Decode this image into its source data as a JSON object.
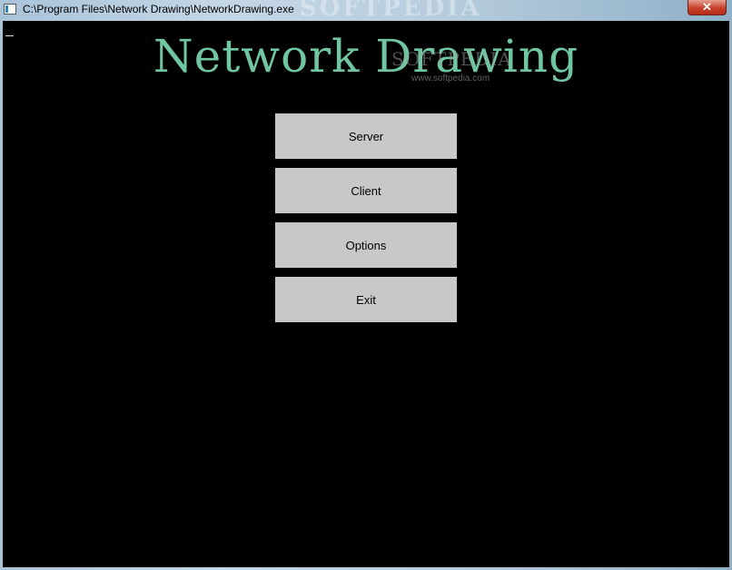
{
  "window": {
    "title": "C:\\Program Files\\Network Drawing\\NetworkDrawing.exe",
    "close_label": "✕",
    "watermark": "SOFTPEDIA"
  },
  "main": {
    "app_title": "Network Drawing",
    "watermark": "SOFTPEDIA",
    "watermark_url": "www.softpedia.com",
    "buttons": {
      "server": "Server",
      "client": "Client",
      "options": "Options",
      "exit": "Exit"
    },
    "title_color": "#6fc6a0",
    "button_color": "#c8c8c8",
    "background_color": "#000000"
  }
}
